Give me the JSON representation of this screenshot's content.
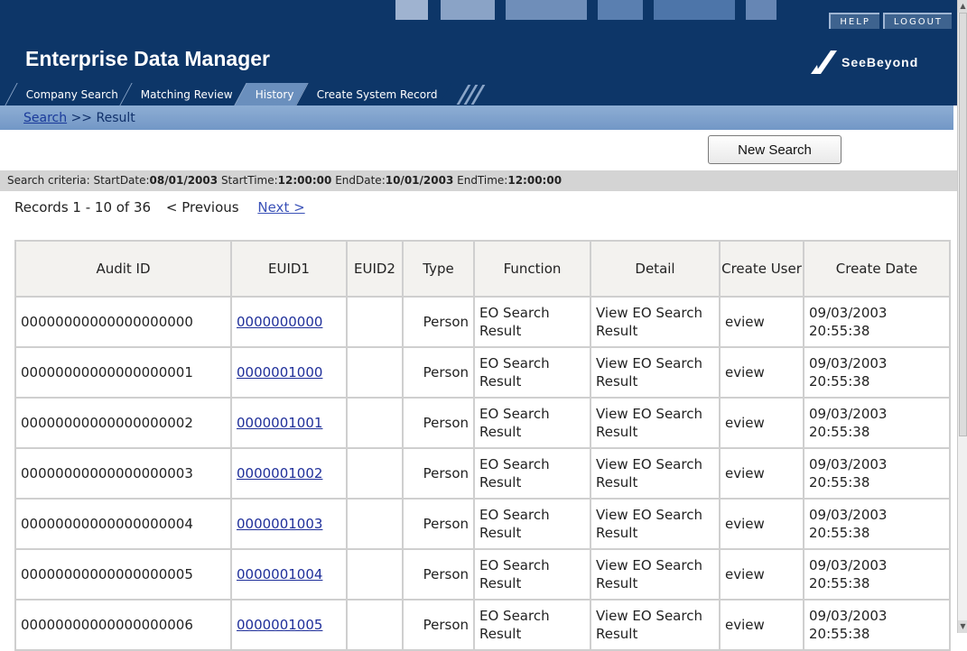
{
  "header": {
    "app_title": "Enterprise Data Manager",
    "logo_text": "SeeBeyond",
    "top_links": [
      "HELP",
      "LOGOUT"
    ]
  },
  "tabs": [
    {
      "label": "Company Search"
    },
    {
      "label": "Matching Review"
    },
    {
      "label": "History",
      "active": true
    },
    {
      "label": "Create System Record"
    }
  ],
  "breadcrumb": {
    "link": "Search",
    "separator": ">>",
    "current": "Result"
  },
  "new_search_label": "New Search",
  "criteria": {
    "prefix": "Search criteria:",
    "start_date_label": "StartDate:",
    "start_date": "08/01/2003",
    "start_time_label": "StartTime:",
    "start_time": "12:00:00",
    "end_date_label": "EndDate:",
    "end_date": "10/01/2003",
    "end_time_label": "EndTime:",
    "end_time": "12:00:00"
  },
  "records": {
    "summary": "Records 1 - 10 of 36",
    "prev": "< Previous",
    "next": "Next >"
  },
  "table": {
    "headers": [
      "Audit ID",
      "EUID1",
      "EUID2",
      "Type",
      "Function",
      "Detail",
      "Create User",
      "Create Date"
    ],
    "rows": [
      {
        "audit_id": "00000000000000000000",
        "euid1": "0000000000",
        "euid2": "",
        "type": "Person",
        "function": "EO Search Result",
        "detail": "View EO Search Result",
        "user": "eview",
        "date": "09/03/2003 20:55:38"
      },
      {
        "audit_id": "00000000000000000001",
        "euid1": "0000001000",
        "euid2": "",
        "type": "Person",
        "function": "EO Search Result",
        "detail": "View EO Search Result",
        "user": "eview",
        "date": "09/03/2003 20:55:38"
      },
      {
        "audit_id": "00000000000000000002",
        "euid1": "0000001001",
        "euid2": "",
        "type": "Person",
        "function": "EO Search Result",
        "detail": "View EO Search Result",
        "user": "eview",
        "date": "09/03/2003 20:55:38"
      },
      {
        "audit_id": "00000000000000000003",
        "euid1": "0000001002",
        "euid2": "",
        "type": "Person",
        "function": "EO Search Result",
        "detail": "View EO Search Result",
        "user": "eview",
        "date": "09/03/2003 20:55:38"
      },
      {
        "audit_id": "00000000000000000004",
        "euid1": "0000001003",
        "euid2": "",
        "type": "Person",
        "function": "EO Search Result",
        "detail": "View EO Search Result",
        "user": "eview",
        "date": "09/03/2003 20:55:38"
      },
      {
        "audit_id": "00000000000000000005",
        "euid1": "0000001004",
        "euid2": "",
        "type": "Person",
        "function": "EO Search Result",
        "detail": "View EO Search Result",
        "user": "eview",
        "date": "09/03/2003 20:55:38"
      },
      {
        "audit_id": "00000000000000000006",
        "euid1": "0000001005",
        "euid2": "",
        "type": "Person",
        "function": "EO Search Result",
        "detail": "View EO Search Result",
        "user": "eview",
        "date": "09/03/2003 20:55:38"
      }
    ]
  }
}
